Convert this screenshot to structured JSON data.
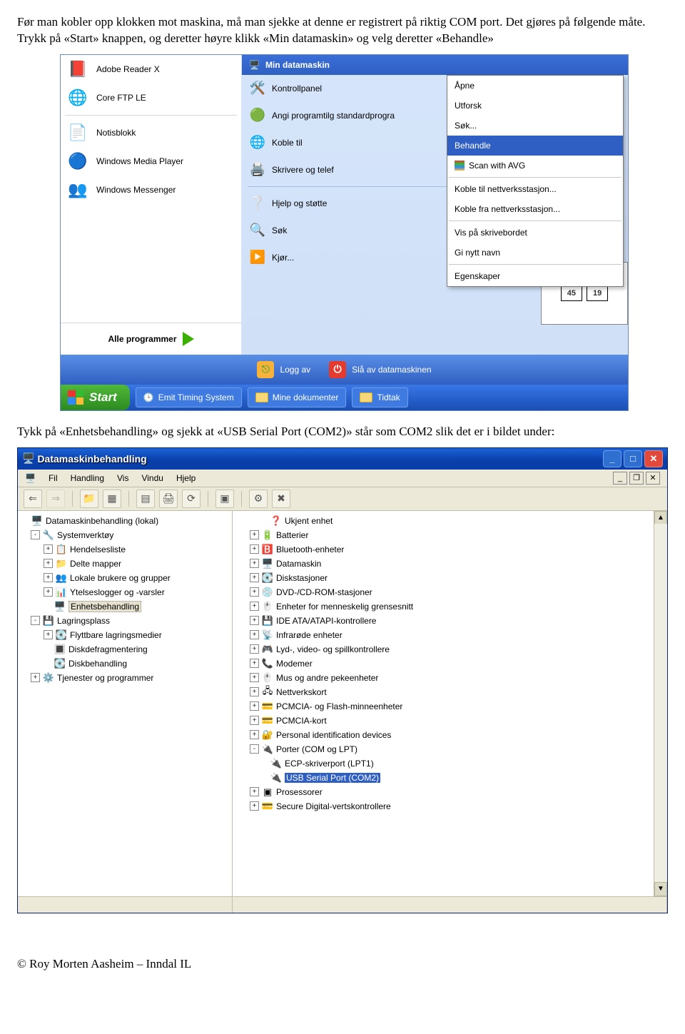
{
  "doc": {
    "p1": "Før man kobler opp klokken mot maskina, må man sjekke at denne er registrert på riktig COM port. Det gjøres på følgende måte. Trykk på «Start» knappen, og deretter høyre klikk «Min datamaskin» og velg deretter «Behandle»",
    "p2": "Tykk på «Enhetsbehandling» og sjekk at «USB Serial Port (COM2)» står som COM2 slik det er i bildet under:",
    "footer": "© Roy Morten Aasheim – Inndal IL"
  },
  "startmenu": {
    "left_items": [
      {
        "label": "Adobe Reader X",
        "icon": "📕"
      },
      {
        "label": "Core FTP LE",
        "icon": "🌐"
      },
      {
        "label": "Notisblokk",
        "icon": "📄"
      },
      {
        "label": "Windows Media Player",
        "icon": "🔵"
      },
      {
        "label": "Windows Messenger",
        "icon": "👥"
      }
    ],
    "all_programs": "Alle programmer",
    "header": "Min datamaskin",
    "right_items": [
      {
        "label": "Kontrollpanel",
        "icon": "🛠️"
      },
      {
        "label": "Angi programtilg\nstandardprogra",
        "icon": "🟢"
      },
      {
        "label": "Koble til",
        "icon": "🌐"
      },
      {
        "label": "Skrivere og telef",
        "icon": "🖨️"
      },
      {
        "label": "Hjelp og støtte",
        "icon": "❔"
      },
      {
        "label": "Søk",
        "icon": "🔍"
      },
      {
        "label": "Kjør...",
        "icon": "▶️"
      }
    ],
    "ctx": [
      "Åpne",
      "Utforsk",
      "Søk...",
      "Behandle",
      "Scan with AVG",
      "Koble til nettverksstasjon...",
      "Koble fra nettverksstasjon...",
      "Vis på skrivebordet",
      "Gi nytt navn",
      "Egenskaper"
    ],
    "logoff": "Logg av",
    "shutdown": "Slå av datamaskinen",
    "start": "Start",
    "task1": "Emit Timing System",
    "task2": "Mine dokumenter",
    "task3": "Tidtak",
    "map_a": "45",
    "map_b": "19"
  },
  "mgmt": {
    "title": "Datamaskinbehandling",
    "menu": [
      "Fil",
      "Handling",
      "Vis",
      "Vindu",
      "Hjelp"
    ],
    "left_tree": [
      {
        "ind": 0,
        "exp": "",
        "icon": "🖥️",
        "label": "Datamaskinbehandling (lokal)"
      },
      {
        "ind": 1,
        "exp": "-",
        "icon": "🔧",
        "label": "Systemverktøy"
      },
      {
        "ind": 2,
        "exp": "+",
        "icon": "📋",
        "label": "Hendelsesliste"
      },
      {
        "ind": 2,
        "exp": "+",
        "icon": "📁",
        "label": "Delte mapper"
      },
      {
        "ind": 2,
        "exp": "+",
        "icon": "👥",
        "label": "Lokale brukere og grupper"
      },
      {
        "ind": 2,
        "exp": "+",
        "icon": "📊",
        "label": "Ytelseslogger og -varsler"
      },
      {
        "ind": 2,
        "exp": "",
        "icon": "🖥️",
        "label": "Enhetsbehandling",
        "sel": true
      },
      {
        "ind": 1,
        "exp": "-",
        "icon": "💾",
        "label": "Lagringsplass"
      },
      {
        "ind": 2,
        "exp": "+",
        "icon": "💽",
        "label": "Flyttbare lagringsmedier"
      },
      {
        "ind": 2,
        "exp": "",
        "icon": "🔳",
        "label": "Diskdefragmentering"
      },
      {
        "ind": 2,
        "exp": "",
        "icon": "💽",
        "label": "Diskbehandling"
      },
      {
        "ind": 1,
        "exp": "+",
        "icon": "⚙️",
        "label": "Tjenester og programmer"
      }
    ],
    "right_tree": [
      {
        "ind": 1,
        "exp": "",
        "icon": "❓",
        "label": "Ukjent enhet"
      },
      {
        "ind": 0,
        "exp": "+",
        "icon": "🔋",
        "label": "Batterier"
      },
      {
        "ind": 0,
        "exp": "+",
        "icon": "🅱️",
        "label": "Bluetooth-enheter"
      },
      {
        "ind": 0,
        "exp": "+",
        "icon": "🖥️",
        "label": "Datamaskin"
      },
      {
        "ind": 0,
        "exp": "+",
        "icon": "💽",
        "label": "Diskstasjoner"
      },
      {
        "ind": 0,
        "exp": "+",
        "icon": "💿",
        "label": "DVD-/CD-ROM-stasjoner"
      },
      {
        "ind": 0,
        "exp": "+",
        "icon": "🖱️",
        "label": "Enheter for menneskelig grensesnitt"
      },
      {
        "ind": 0,
        "exp": "+",
        "icon": "💾",
        "label": "IDE ATA/ATAPI-kontrollere"
      },
      {
        "ind": 0,
        "exp": "+",
        "icon": "📡",
        "label": "Infrarøde enheter"
      },
      {
        "ind": 0,
        "exp": "+",
        "icon": "🎮",
        "label": "Lyd-, video- og spillkontrollere"
      },
      {
        "ind": 0,
        "exp": "+",
        "icon": "📞",
        "label": "Modemer"
      },
      {
        "ind": 0,
        "exp": "+",
        "icon": "🖱️",
        "label": "Mus og andre pekeenheter"
      },
      {
        "ind": 0,
        "exp": "+",
        "icon": "🖧",
        "label": "Nettverkskort"
      },
      {
        "ind": 0,
        "exp": "+",
        "icon": "💳",
        "label": "PCMCIA- og Flash-minneenheter"
      },
      {
        "ind": 0,
        "exp": "+",
        "icon": "💳",
        "label": "PCMCIA-kort"
      },
      {
        "ind": 0,
        "exp": "+",
        "icon": "🔐",
        "label": "Personal identification devices"
      },
      {
        "ind": 0,
        "exp": "-",
        "icon": "🔌",
        "label": "Porter (COM og LPT)"
      },
      {
        "ind": 1,
        "exp": "",
        "icon": "🔌",
        "label": "ECP-skriverport (LPT1)"
      },
      {
        "ind": 1,
        "exp": "",
        "icon": "🔌",
        "label": "USB Serial Port (COM2)",
        "hl": true
      },
      {
        "ind": 0,
        "exp": "+",
        "icon": "▣",
        "label": "Prosessorer"
      },
      {
        "ind": 0,
        "exp": "+",
        "icon": "💳",
        "label": "Secure Digital-vertskontrollere"
      }
    ]
  }
}
